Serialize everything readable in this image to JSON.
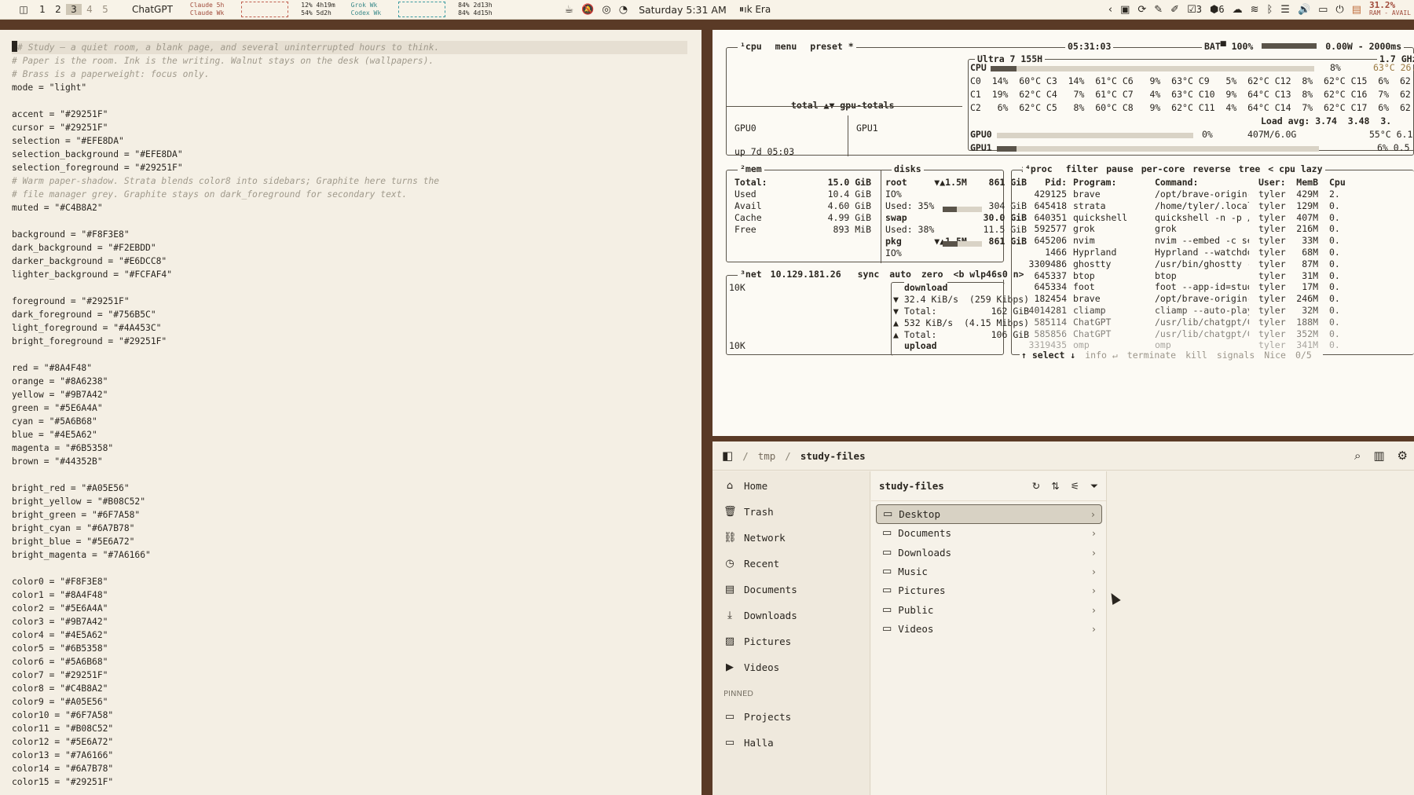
{
  "topbar": {
    "workspaces": [
      "1",
      "2",
      "3",
      "4",
      "5"
    ],
    "active_workspace": "3",
    "app_title": "ChatGPT",
    "claude_label_1": "Claude 5h",
    "claude_label_2": "Claude Wk",
    "claude_stat_1": "12% 4h19m",
    "claude_stat_2": "54% 5d2h",
    "grok_label_1": "Grok Wk",
    "grok_label_2": "Codex Wk",
    "grok_stat_1": "84% 2d13h",
    "grok_stat_2": "84% 4d15h",
    "datetime": "Saturday 5:31 AM",
    "media": "ık Era",
    "badge_count_1": "3",
    "badge_count_2": "6",
    "ram_percent": "31.2%",
    "ram_label": "RAM - AVAIL"
  },
  "editor": {
    "lines": [
      {
        "text": "# Study — a quiet room, a blank page, and several uninterrupted hours to think.",
        "type": "comment",
        "hl": true,
        "cursor": true
      },
      {
        "text": "# Paper is the room. Ink is the writing. Walnut stays on the desk (wallpapers).",
        "type": "comment"
      },
      {
        "text": "# Brass is a paperweight: focus only.",
        "type": "comment"
      },
      {
        "text": "mode = \"light\"",
        "type": "code"
      },
      {
        "text": "",
        "type": "code"
      },
      {
        "text": "accent = \"#29251F\"",
        "type": "code"
      },
      {
        "text": "cursor = \"#29251F\"",
        "type": "code"
      },
      {
        "text": "selection = \"#EFE8DA\"",
        "type": "code"
      },
      {
        "text": "selection_background = \"#EFE8DA\"",
        "type": "code"
      },
      {
        "text": "selection_foreground = \"#29251F\"",
        "type": "code"
      },
      {
        "text": "# Warm paper-shadow. Strata blends color8 into sidebars; Graphite here turns the",
        "type": "comment"
      },
      {
        "text": "# file manager grey. Graphite stays on dark_foreground for secondary text.",
        "type": "comment"
      },
      {
        "text": "muted = \"#C4B8A2\"",
        "type": "code"
      },
      {
        "text": "",
        "type": "code"
      },
      {
        "text": "background = \"#F8F3E8\"",
        "type": "code"
      },
      {
        "text": "dark_background = \"#F2EBDD\"",
        "type": "code"
      },
      {
        "text": "darker_background = \"#E6DCC8\"",
        "type": "code"
      },
      {
        "text": "lighter_background = \"#FCFAF4\"",
        "type": "code"
      },
      {
        "text": "",
        "type": "code"
      },
      {
        "text": "foreground = \"#29251F\"",
        "type": "code"
      },
      {
        "text": "dark_foreground = \"#756B5C\"",
        "type": "code"
      },
      {
        "text": "light_foreground = \"#4A453C\"",
        "type": "code"
      },
      {
        "text": "bright_foreground = \"#29251F\"",
        "type": "code"
      },
      {
        "text": "",
        "type": "code"
      },
      {
        "text": "red = \"#8A4F48\"",
        "type": "code"
      },
      {
        "text": "orange = \"#8A6238\"",
        "type": "code"
      },
      {
        "text": "yellow = \"#9B7A42\"",
        "type": "code"
      },
      {
        "text": "green = \"#5E6A4A\"",
        "type": "code"
      },
      {
        "text": "cyan = \"#5A6B68\"",
        "type": "code"
      },
      {
        "text": "blue = \"#4E5A62\"",
        "type": "code"
      },
      {
        "text": "magenta = \"#6B5358\"",
        "type": "code"
      },
      {
        "text": "brown = \"#44352B\"",
        "type": "code"
      },
      {
        "text": "",
        "type": "code"
      },
      {
        "text": "bright_red = \"#A05E56\"",
        "type": "code"
      },
      {
        "text": "bright_yellow = \"#B08C52\"",
        "type": "code"
      },
      {
        "text": "bright_green = \"#6F7A58\"",
        "type": "code"
      },
      {
        "text": "bright_cyan = \"#6A7B78\"",
        "type": "code"
      },
      {
        "text": "bright_blue = \"#5E6A72\"",
        "type": "code"
      },
      {
        "text": "bright_magenta = \"#7A6166\"",
        "type": "code"
      },
      {
        "text": "",
        "type": "code"
      },
      {
        "text": "color0 = \"#F8F3E8\"",
        "type": "code"
      },
      {
        "text": "color1 = \"#8A4F48\"",
        "type": "code"
      },
      {
        "text": "color2 = \"#5E6A4A\"",
        "type": "code"
      },
      {
        "text": "color3 = \"#9B7A42\"",
        "type": "code"
      },
      {
        "text": "color4 = \"#4E5A62\"",
        "type": "code"
      },
      {
        "text": "color5 = \"#6B5358\"",
        "type": "code"
      },
      {
        "text": "color6 = \"#5A6B68\"",
        "type": "code"
      },
      {
        "text": "color7 = \"#29251F\"",
        "type": "code"
      },
      {
        "text": "color8 = \"#C4B8A2\"",
        "type": "code"
      },
      {
        "text": "color9 = \"#A05E56\"",
        "type": "code"
      },
      {
        "text": "color10 = \"#6F7A58\"",
        "type": "code"
      },
      {
        "text": "color11 = \"#B08C52\"",
        "type": "code"
      },
      {
        "text": "color12 = \"#5E6A72\"",
        "type": "code"
      },
      {
        "text": "color13 = \"#7A6166\"",
        "type": "code"
      },
      {
        "text": "color14 = \"#6A7B78\"",
        "type": "code"
      },
      {
        "text": "color15 = \"#29251F\"",
        "type": "code"
      }
    ]
  },
  "btop": {
    "cpu_box": {
      "title": "¹cpu",
      "tabs": [
        "menu",
        "preset *"
      ],
      "clock": "05:31:03",
      "battery": "BAT▀ 100%",
      "battery_level": 1.0,
      "power": "0.00W",
      "interval": "- 2000ms",
      "cpu_name": "Ultra 7 155H",
      "freq": "1.7 GHz",
      "cpu_total_label": "CPU",
      "cpu_total_pct": "8%",
      "cpu_total_level": 0.08,
      "cpu_temp": "63°C 26.",
      "core_rows": [
        "C0  14%  60°C C3  14%  61°C C6   9%  63°C C9   5%  62°C C12  8%  62°C C15  6%  62",
        "C1  19%  62°C C4   7%  61°C C7   4%  63°C C10  9%  64°C C13  8%  62°C C16  7%  62",
        "C2   6%  62°C C5   8%  60°C C8   9%  62°C C11  4%  64°C C14  7%  62°C C17  6%  62"
      ],
      "load_avg": "Load avg: 3.74  3.48  3.",
      "graph_label": "total ▲▼ gpu-totals",
      "gpu0_label": "GPU0",
      "gpu1_label": "GPU1",
      "uptime": "up 7d 05:03",
      "gpu0_row_label": "GPU0",
      "gpu0_pct": "0%",
      "gpu0_mem": "407M/6.0G",
      "gpu0_temp": "55°C 6.1",
      "gpu1_row_label": "GPU1",
      "gpu1_pct": "6% 0.5",
      "gpu1_level": 0.06
    },
    "mem_box": {
      "title": "²mem",
      "rows": [
        {
          "label": "Total:",
          "value": "15.0 GiB"
        },
        {
          "label": "Used",
          "value": "10.4 GiB"
        },
        {
          "label": "Avail",
          "value": "4.60 GiB"
        },
        {
          "label": "Cache",
          "value": "4.99 GiB"
        },
        {
          "label": "Free",
          "value": "893 MiB"
        }
      ]
    },
    "disks_box": {
      "title": "disks",
      "io_label": "io",
      "rows": [
        "root     ▼▲1.5M    861 GiB",
        "IO%",
        "Used: 35%          304 GiB",
        "swap              30.0 GiB",
        "Used: 38%         11.5 GiB",
        "pkg      ▼▲1.5M    861 GiB",
        "IO%"
      ],
      "root_used_level": 0.35,
      "swap_used_level": 0.38
    },
    "net_box": {
      "title": "³net",
      "ip": "10.129.181.26",
      "tabs": [
        "sync",
        "auto",
        "zero",
        "<b wlp46s0 n>"
      ],
      "scale_top": "10K",
      "scale_bottom": "10K",
      "download_label": "download",
      "upload_label": "upload",
      "rows": [
        "▼ 32.4 KiB/s  (259 Kibps)",
        "▼ Total:          162 GiB",
        "▲ 532 KiB/s  (4.15 Mibps)",
        "▲ Total:          106 GiB"
      ]
    },
    "proc_box": {
      "title": "⁴proc",
      "tabs": [
        "filter",
        "pause",
        "per-core",
        "reverse",
        "tree",
        "< cpu lazy"
      ],
      "headers": {
        "pid": "Pid:",
        "program": "Program:",
        "command": "Command:",
        "user": "User:",
        "mem": "MemB",
        "cpu": "Cpu"
      },
      "rows": [
        {
          "pid": "429125",
          "program": "brave",
          "command": "/opt/brave-origin-",
          "user": "tyler",
          "mem": "429M",
          "cpu": "2."
        },
        {
          "pid": "645418",
          "program": "strata",
          "command": "/home/tyler/.local",
          "user": "tyler",
          "mem": "129M",
          "cpu": "0."
        },
        {
          "pid": "640351",
          "program": "quickshell",
          "command": "quickshell -n -p /",
          "user": "tyler",
          "mem": "407M",
          "cpu": "0."
        },
        {
          "pid": "592577",
          "program": "grok",
          "command": "grok",
          "user": "tyler",
          "mem": "216M",
          "cpu": "0."
        },
        {
          "pid": "645206",
          "program": "nvim",
          "command": "nvim --embed -c se",
          "user": "tyler",
          "mem": "33M",
          "cpu": "0."
        },
        {
          "pid": "1466",
          "program": "Hyprland",
          "command": "Hyprland --watchdo",
          "user": "tyler",
          "mem": "68M",
          "cpu": "0."
        },
        {
          "pid": "3309486",
          "program": "ghostty",
          "command": "/usr/bin/ghostty -",
          "user": "tyler",
          "mem": "87M",
          "cpu": "0."
        },
        {
          "pid": "645337",
          "program": "btop",
          "command": "btop",
          "user": "tyler",
          "mem": "31M",
          "cpu": "0."
        },
        {
          "pid": "645334",
          "program": "foot",
          "command": "foot --app-id=stud",
          "user": "tyler",
          "mem": "17M",
          "cpu": "0."
        },
        {
          "pid": "182454",
          "program": "brave",
          "command": "/opt/brave-origin-",
          "user": "tyler",
          "mem": "246M",
          "cpu": "0."
        },
        {
          "pid": "4014281",
          "program": "cliamp",
          "command": "cliamp --auto-play",
          "user": "tyler",
          "mem": "32M",
          "cpu": "0."
        },
        {
          "pid": "585114",
          "program": "ChatGPT",
          "command": "/usr/lib/chatgpt/C",
          "user": "tyler",
          "mem": "188M",
          "cpu": "0."
        },
        {
          "pid": "585856",
          "program": "ChatGPT",
          "command": "/usr/lib/chatgpt/C",
          "user": "tyler",
          "mem": "352M",
          "cpu": "0."
        },
        {
          "pid": "3319435",
          "program": "omp",
          "command": "omp",
          "user": "tyler",
          "mem": "341M",
          "cpu": "0."
        }
      ],
      "footer": [
        "↑ select ↓",
        "info ↵",
        "terminate",
        "kill",
        "signals",
        "Nice",
        "0/5"
      ]
    }
  },
  "filemanager": {
    "breadcrumb": [
      "/",
      "tmp",
      "/",
      "study-files"
    ],
    "sidebar": [
      {
        "label": "Home",
        "icon": "home-icon"
      },
      {
        "label": "Trash",
        "icon": "trash-icon"
      },
      {
        "label": "Network",
        "icon": "network-icon"
      },
      {
        "label": "Recent",
        "icon": "clock-icon"
      },
      {
        "label": "Documents",
        "icon": "document-icon"
      },
      {
        "label": "Downloads",
        "icon": "download-icon"
      },
      {
        "label": "Pictures",
        "icon": "image-icon"
      },
      {
        "label": "Videos",
        "icon": "video-icon"
      }
    ],
    "pinned_label": "PINNED",
    "pinned": [
      {
        "label": "Projects",
        "icon": "folder-icon"
      },
      {
        "label": "Halla",
        "icon": "folder-icon"
      }
    ],
    "column_title": "study-files",
    "folders": [
      "Desktop",
      "Documents",
      "Downloads",
      "Music",
      "Pictures",
      "Public",
      "Videos"
    ],
    "selected_folder": "Desktop"
  },
  "colors": {
    "paper": "#F8F3E8",
    "ink": "#29251F",
    "walnut": "#5a3a26",
    "muted": "#C4B8A2"
  }
}
